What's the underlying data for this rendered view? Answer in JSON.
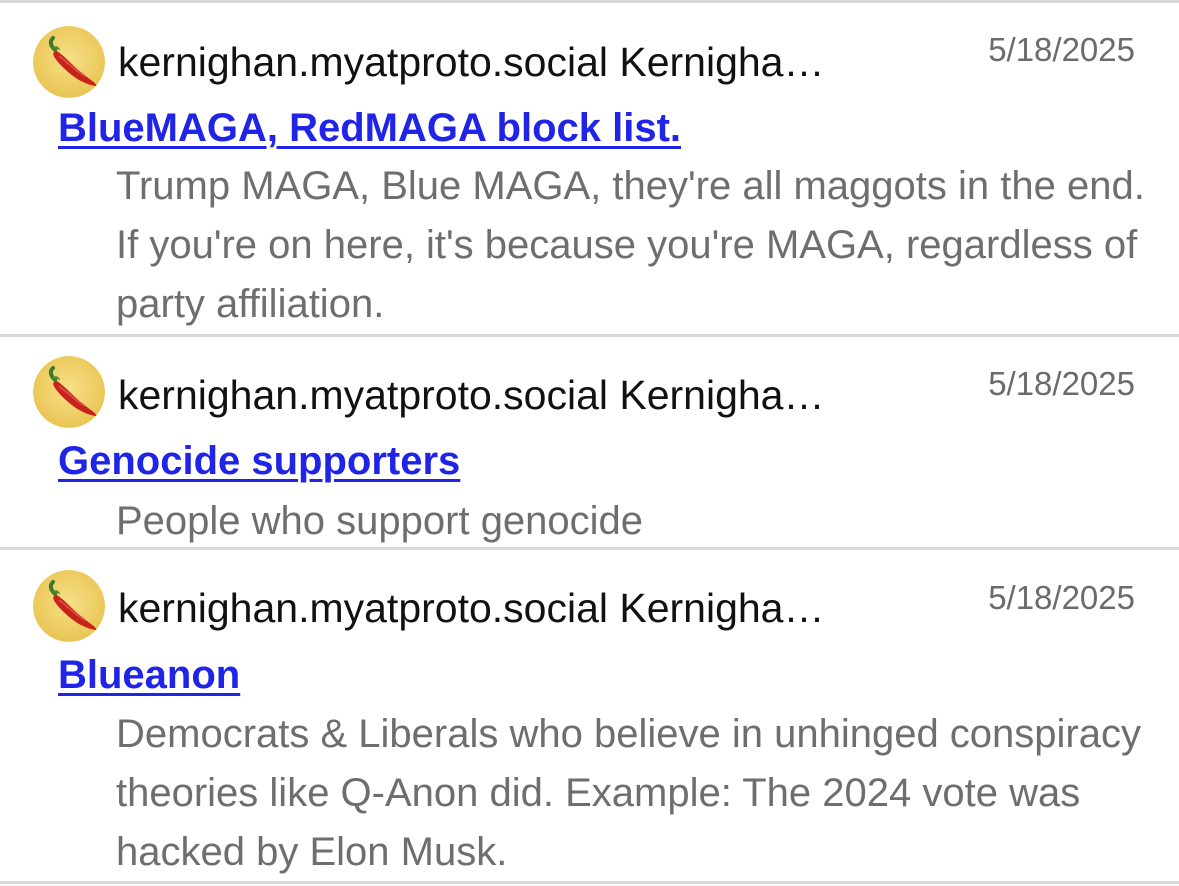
{
  "lists": [
    {
      "author": "kernighan.myatproto.social Kernigha…",
      "date": "5/18/2025",
      "title": "BlueMAGA, RedMAGA block list.",
      "description": "Trump MAGA, Blue MAGA, they're all maggots in the end. If you're on here, it's because you're MAGA, regardless of party affiliation."
    },
    {
      "author": "kernighan.myatproto.social Kernigha…",
      "date": "5/18/2025",
      "title": "Genocide supporters",
      "description": "People who support genocide"
    },
    {
      "author": "kernighan.myatproto.social Kernigha…",
      "date": "5/18/2025",
      "title": "Blueanon",
      "description": "Democrats & Liberals who believe in unhinged conspiracy theories like Q-Anon did. Example: The 2024 vote was hacked by Elon Musk."
    }
  ],
  "colors": {
    "link": "#1f24e6",
    "description": "#6e6e6e",
    "author": "#111111",
    "date": "#6b6b6b",
    "divider": "#d9d9d9",
    "avatar_bg": "#f2d36b",
    "avatar_icon": "#c8231a"
  },
  "icons": {
    "avatar": "chili-pepper-icon"
  }
}
